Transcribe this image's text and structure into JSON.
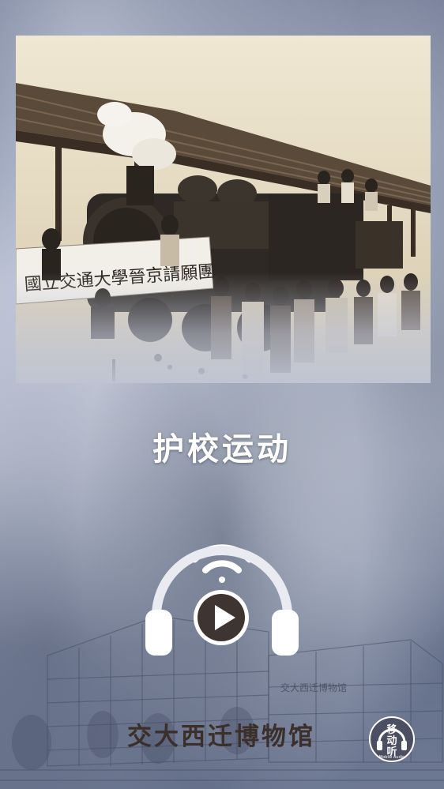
{
  "title": "护校运动",
  "photo": {
    "banner_text": "國立交通大學晉京請願團"
  },
  "player": {
    "play_icon": "play-icon",
    "headphone_icon": "headphone-icon",
    "wifi_icon": "wifi-icon"
  },
  "footer": {
    "museum_name": "交大西迁博物馆",
    "building_sign": "交大西迁博物馆"
  },
  "badge": {
    "line1": "移",
    "line2": "动",
    "line3": "听",
    "subtext": "Mobile Audio"
  },
  "colors": {
    "title": "#ffffff",
    "footer_text": "#3b2f2a",
    "background": "#5f6a86",
    "play_circle": "#3e3432"
  }
}
